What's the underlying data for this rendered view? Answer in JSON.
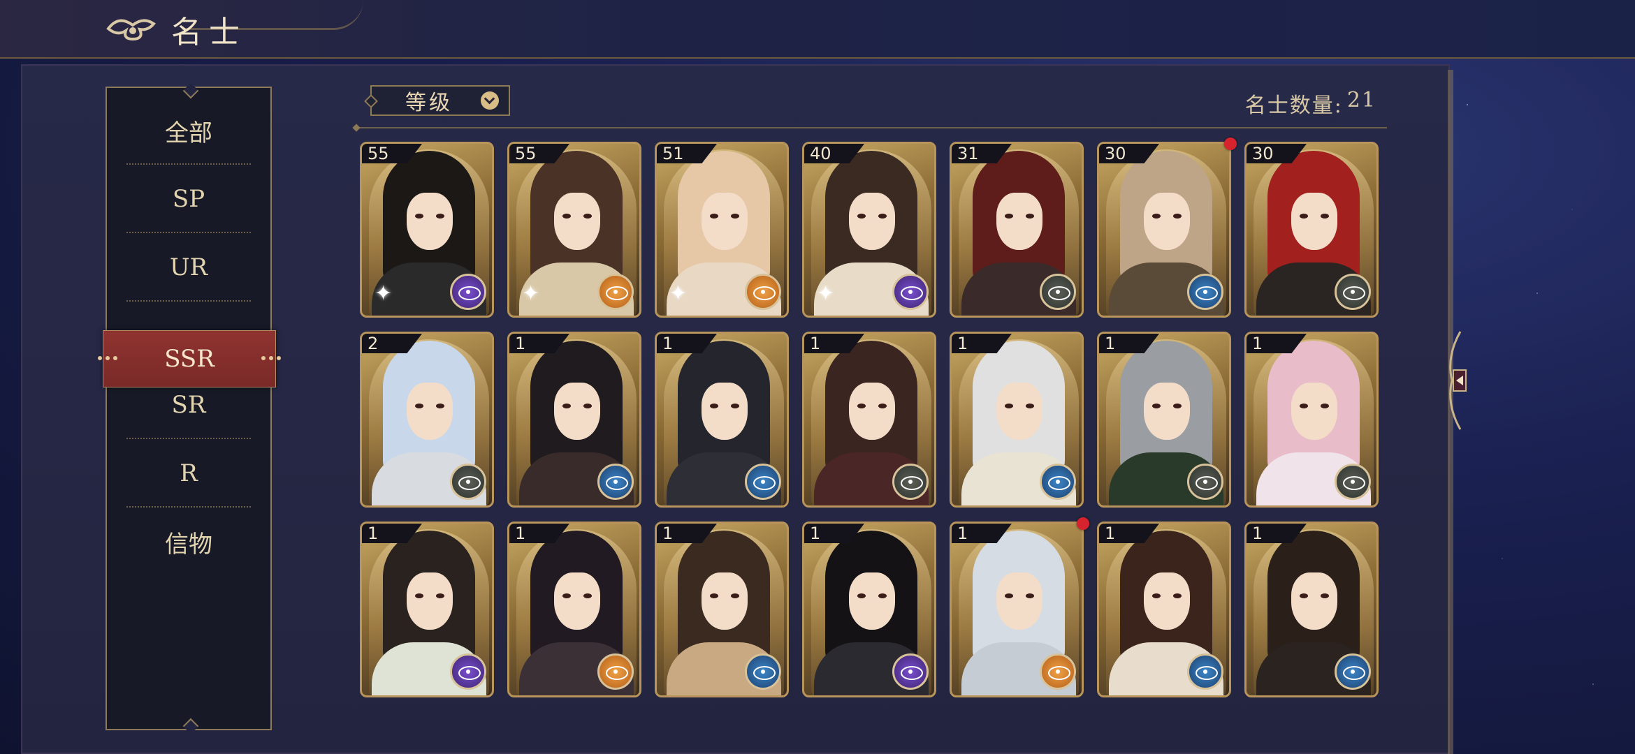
{
  "header": {
    "title": "名士"
  },
  "sidebar": {
    "items": [
      {
        "label": "全部"
      },
      {
        "label": "SP"
      },
      {
        "label": "UR"
      },
      {
        "label": "SSR",
        "active": true
      },
      {
        "label": "SR"
      },
      {
        "label": "R"
      },
      {
        "label": "信物"
      }
    ]
  },
  "filter": {
    "sort_label": "等级"
  },
  "summary": {
    "count_label": "名士数量:",
    "count_value": "21"
  },
  "cards": [
    {
      "level": "55",
      "attr": "purple",
      "hair": "#1c1816",
      "body": "#2a2a2a",
      "sparkle": true
    },
    {
      "level": "55",
      "attr": "orange",
      "hair": "#4a3226",
      "body": "#d9c8a8",
      "sparkle": true
    },
    {
      "level": "51",
      "attr": "orange",
      "hair": "#e6c7a6",
      "body": "#e8d8c4",
      "sparkle": true
    },
    {
      "level": "40",
      "attr": "purple",
      "hair": "#3a2a22",
      "body": "#e8dcc8",
      "sparkle": true
    },
    {
      "level": "31",
      "attr": "gray",
      "hair": "#5e1d1a",
      "body": "#3b2a2a",
      "sparkle": false
    },
    {
      "level": "30",
      "attr": "blue",
      "hair": "#bfa588",
      "body": "#5a4a38",
      "sparkle": false,
      "new": true
    },
    {
      "level": "30",
      "attr": "gray",
      "hair": "#a2201e",
      "body": "#2a2522",
      "sparkle": false
    },
    {
      "level": "2",
      "attr": "gray",
      "hair": "#c9d7ea",
      "body": "#d8dbe0",
      "sparkle": false
    },
    {
      "level": "1",
      "attr": "blue",
      "hair": "#1f1b1e",
      "body": "#3a2b2b",
      "sparkle": false
    },
    {
      "level": "1",
      "attr": "blue",
      "hair": "#25252e",
      "body": "#2e2e36",
      "sparkle": false
    },
    {
      "level": "1",
      "attr": "gray",
      "hair": "#3a2520",
      "body": "#4a2626",
      "sparkle": false
    },
    {
      "level": "1",
      "attr": "blue",
      "hair": "#e0e0e0",
      "body": "#e9e3d4",
      "sparkle": false
    },
    {
      "level": "1",
      "attr": "gray",
      "hair": "#9a9da2",
      "body": "#2a3a2a",
      "sparkle": false
    },
    {
      "level": "1",
      "attr": "gray",
      "hair": "#e8bcc8",
      "body": "#f0e4ea",
      "sparkle": false
    },
    {
      "level": "1",
      "attr": "purple",
      "hair": "#2a221e",
      "body": "#dfe3d6",
      "sparkle": false
    },
    {
      "level": "1",
      "attr": "orange",
      "hair": "#221a22",
      "body": "#3a3036",
      "sparkle": false
    },
    {
      "level": "1",
      "attr": "blue",
      "hair": "#3a2a20",
      "body": "#c9a982",
      "sparkle": false
    },
    {
      "level": "1",
      "attr": "purple",
      "hair": "#151215",
      "body": "#2a2a30",
      "sparkle": false
    },
    {
      "level": "1",
      "attr": "orange",
      "hair": "#d6dce4",
      "body": "#c6ccd4",
      "sparkle": false,
      "new": true
    },
    {
      "level": "1",
      "attr": "blue",
      "hair": "#3a241c",
      "body": "#e8dccc",
      "sparkle": false
    },
    {
      "level": "1",
      "attr": "blue",
      "hair": "#2b1f1a",
      "body": "#2a2320",
      "sparkle": false
    }
  ]
}
